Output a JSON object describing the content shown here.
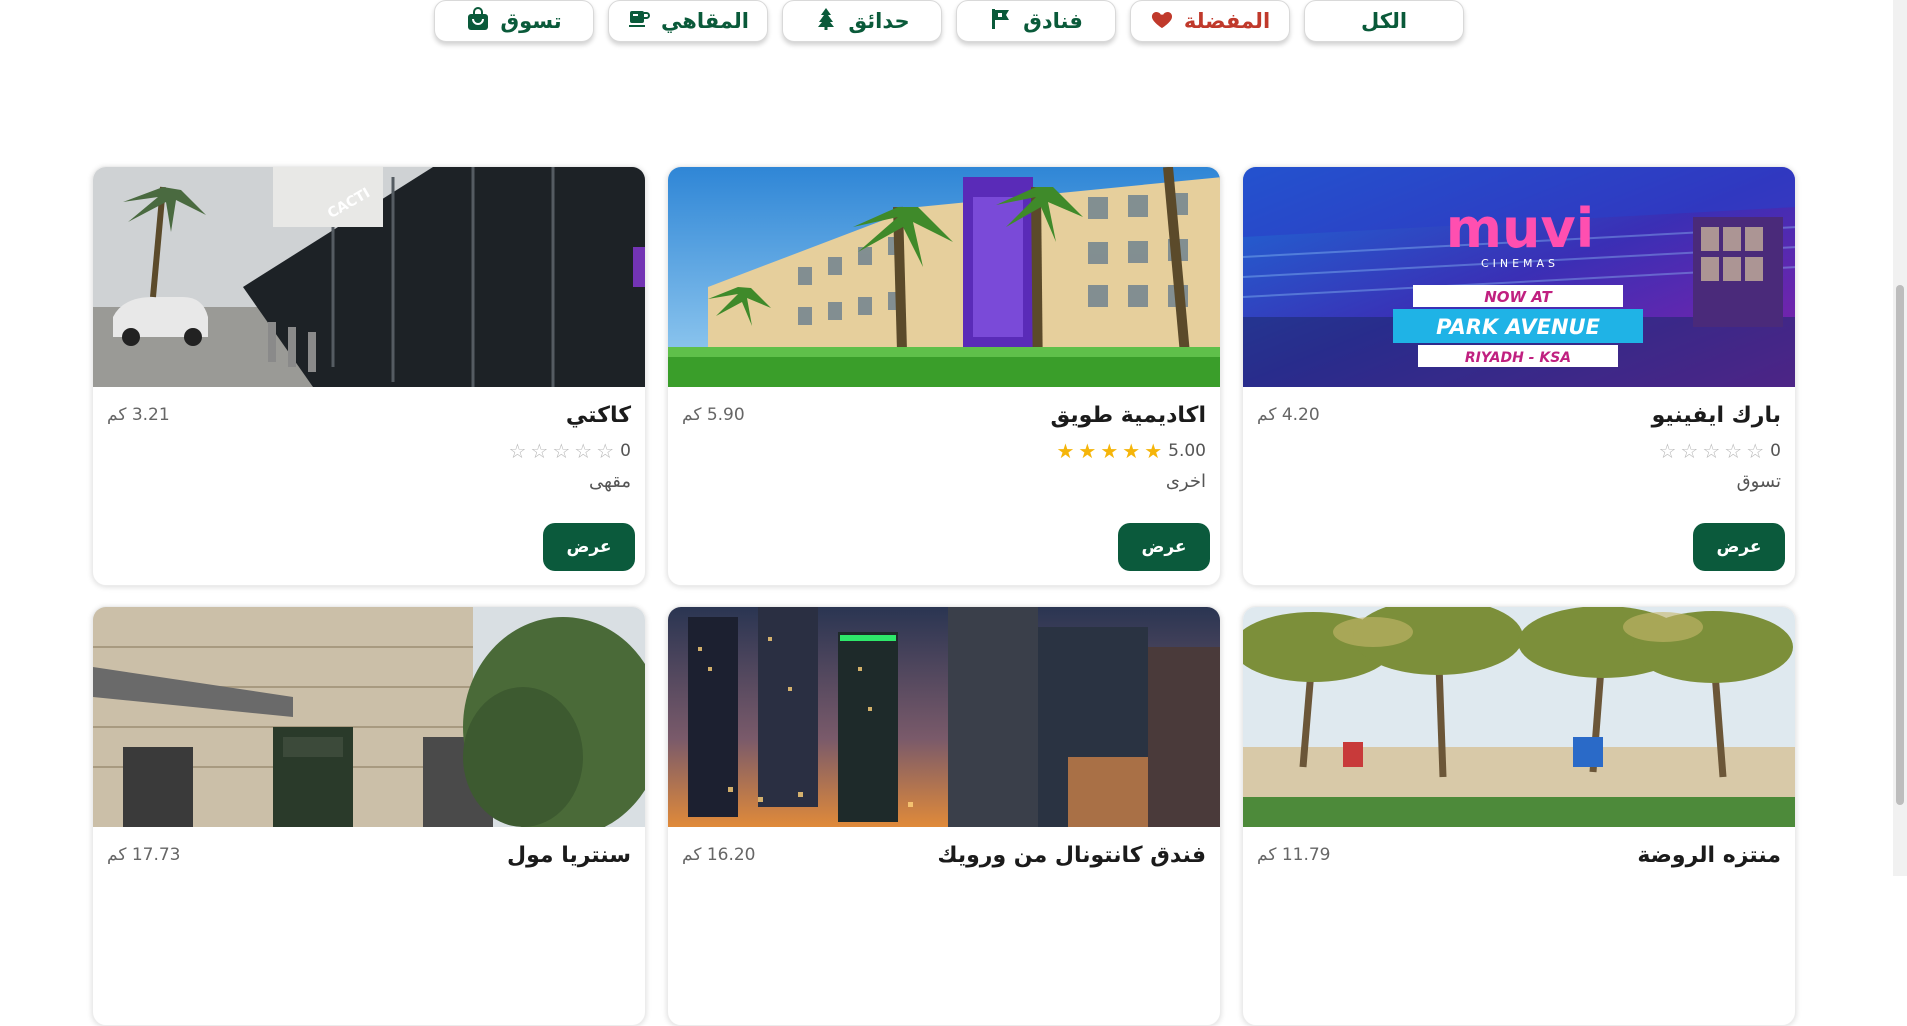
{
  "filters": [
    {
      "label": "الكل",
      "icon": "none",
      "active": false
    },
    {
      "label": "المفضلة",
      "icon": "heart-icon",
      "accent": "#c0392b"
    },
    {
      "label": "فنادق",
      "icon": "flag-icon"
    },
    {
      "label": "حدائق",
      "icon": "tree-icon"
    },
    {
      "label": "المقاهي",
      "icon": "coffee-cup-icon"
    },
    {
      "label": "تسوق",
      "icon": "shopping-bag-icon"
    }
  ],
  "colors": {
    "brand": "#0b5a3c",
    "favorite": "#c0392b",
    "star": "#f5b50a"
  },
  "view_label": "عرض",
  "cards": [
    {
      "title": "بارك ايفينيو",
      "distance": "4.20 كم",
      "rating": "0",
      "rating_value": 0,
      "category": "تسوق",
      "image": "muvi-cinemas-banner",
      "banner_text": [
        "muvi",
        "CINEMAS",
        "NOW AT",
        "PARK AVENUE",
        "RIYADH - KSA"
      ]
    },
    {
      "title": "اكاديمية طويق",
      "distance": "5.90 كم",
      "rating": "5.00",
      "rating_value": 5,
      "category": "اخرى",
      "image": "academy-building-with-palms"
    },
    {
      "title": "كاكتي",
      "distance": "3.21 كم",
      "rating": "0",
      "rating_value": 0,
      "category": "مقهى",
      "image": "cafe-glass-facade",
      "sign_text": "CACTI"
    },
    {
      "title": "منتزه الروضة",
      "distance": "11.79 كم",
      "image": "park-palm-trees"
    },
    {
      "title": "فندق كانتونال من ورويك",
      "distance": "16.20 كم",
      "image": "city-towers-at-dusk"
    },
    {
      "title": "سنتريا مول",
      "distance": "17.73 كم",
      "image": "mall-entrance"
    }
  ]
}
